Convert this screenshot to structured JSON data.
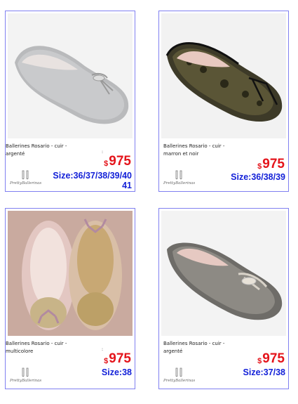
{
  "products": [
    {
      "title_line1": "Ballerines Rosario - cuir -",
      "title_line2": "argenté",
      "price_currency": "$",
      "price": "975",
      "size_line1": "Size:36/37/38/39/40",
      "size_line2": "41",
      "brand": "PrettyBallerinas",
      "colon": ":"
    },
    {
      "title_line1": "Ballerines Rosario - cuir -",
      "title_line2": "marron et noir",
      "price_currency": "$",
      "price": "975",
      "size_line1": "Size:36/38/39",
      "size_line2": "",
      "brand": "PrettyBallerinas",
      "colon": ""
    },
    {
      "title_line1": "Ballerines Rosario - cuir -",
      "title_line2": "multicolore",
      "price_currency": "$",
      "price": "975",
      "size_line1": "Size:38",
      "size_line2": "",
      "brand": "PrettyBallerinas",
      "colon": ":"
    },
    {
      "title_line1": "Ballerines Rosario - cuir -",
      "title_line2": "argenté",
      "price_currency": "$",
      "price": "975",
      "size_line1": "Size:37/38",
      "size_line2": "",
      "brand": "PrettyBallerinas",
      "colon": ""
    }
  ],
  "colors": {
    "card_border": "#8080f0",
    "price": "#e4141b",
    "size": "#1321d8"
  }
}
